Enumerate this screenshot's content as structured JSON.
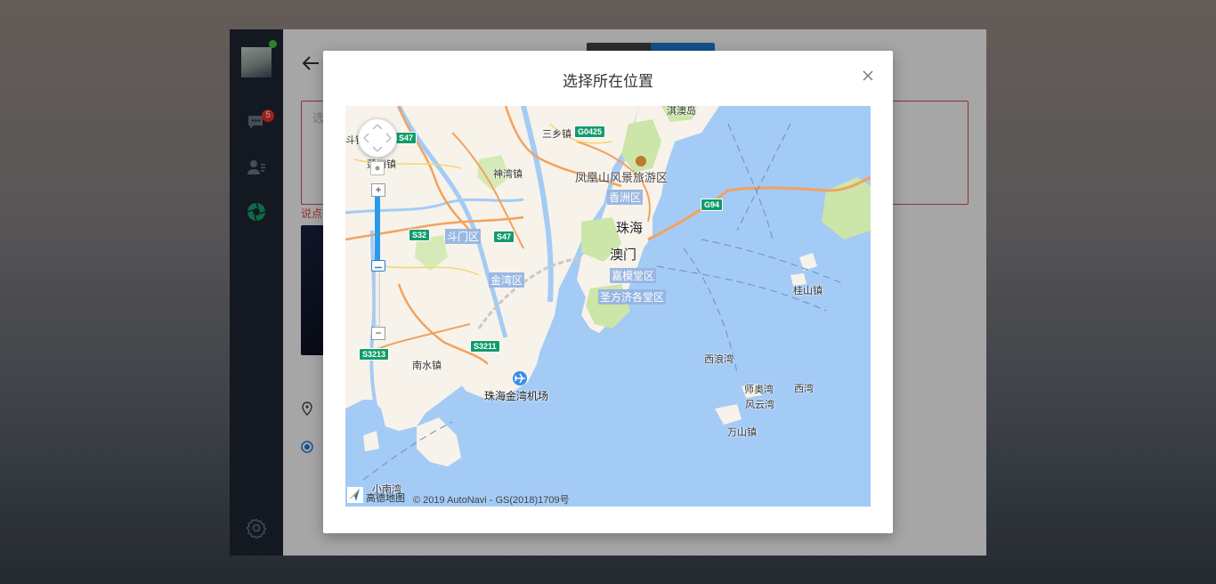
{
  "app": {
    "badge_count": "5",
    "textarea_placeholder": "选",
    "hint_text": "说点"
  },
  "modal": {
    "title": "选择所在位置"
  },
  "map": {
    "labels": {
      "qiao": "淇澳岛",
      "sanxiang": "三乡镇",
      "shenwan": "神湾镇",
      "lianzhou": "莲洲镇",
      "fenghuang": "凤凰山风景旅游区",
      "xiangzhou": "香洲区",
      "zhuhai": "珠海",
      "doumen": "斗门区",
      "macau": "澳门",
      "jiamo": "嘉模堂区",
      "jinwan": "金湾区",
      "shengfang": "圣方济各堂区",
      "guishan": "桂山镇",
      "nanshui": "南水镇",
      "airport": "珠海金湾机场",
      "xilang": "西浪湾",
      "shiaowan": "师奥湾",
      "xiwan": "西湾",
      "fengyun": "风云湾",
      "wanshan": "万山镇",
      "xiaonanwan": "小南湾",
      "douji": "斗镇"
    },
    "shields": {
      "s47a": "S47",
      "s47b": "S47",
      "g0425": "G0425",
      "g94": "G94",
      "s32": "S32",
      "s3211": "S3211",
      "s3213": "S3213"
    },
    "logo_text": "高德地图",
    "copyright": "© 2019 AutoNavi - GS(2018)1709号"
  },
  "colors": {
    "accent": "#1e7fd8",
    "water": "#a4cbf6",
    "land": "#f7f3ea",
    "road": "#f3a25e",
    "highway_shield": "#119c6b",
    "error": "#e04848"
  }
}
